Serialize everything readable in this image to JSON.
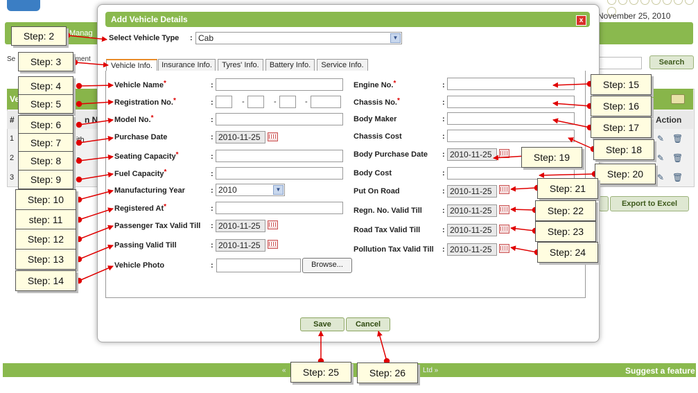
{
  "background": {
    "date": "November 25, 2010",
    "nav_text": "Manag",
    "set_text": "Se",
    "ement_text": "ement",
    "search_button": "Search",
    "table_title": "Ve",
    "col_hash": "#",
    "col_number": "n No",
    "col_action": "Action",
    "rows": [
      "1",
      "2",
      "3"
    ],
    "row_fragments": [
      "ith",
      "a",
      ""
    ],
    "export_button": "Export to Excel",
    "footer_left": "«",
    "footer_ltd": "Ltd »",
    "footer_suggest": "Suggest a feature"
  },
  "modal": {
    "title": "Add Vehicle Details",
    "close_label": "x",
    "vehicle_type_label": "Select Vehicle Type",
    "vehicle_type_value": "Cab",
    "tabs": [
      "Vehicle Info.",
      "Insurance Info.",
      "Tyres' Info.",
      "Battery Info.",
      "Service Info."
    ],
    "left_fields": [
      {
        "label": "Vehicle Name",
        "required": true
      },
      {
        "label": "Registration No.",
        "required": true
      },
      {
        "label": "Model No.",
        "required": true
      },
      {
        "label": "Purchase Date",
        "required": false,
        "value": "2010-11-25"
      },
      {
        "label": "Seating Capacity",
        "required": true
      },
      {
        "label": "Fuel Capacity",
        "required": true
      },
      {
        "label": "Manufacturing Year",
        "required": false,
        "value": "2010"
      },
      {
        "label": "Registered At",
        "required": true
      },
      {
        "label": "Passenger Tax Valid Till",
        "required": false,
        "value": "2010-11-25"
      },
      {
        "label": "Passing Valid Till",
        "required": false,
        "value": "2010-11-25"
      },
      {
        "label": "Vehicle Photo",
        "required": false
      }
    ],
    "right_fields": [
      {
        "label": "Engine No.",
        "required": true
      },
      {
        "label": "Chassis No.",
        "required": true
      },
      {
        "label": "Body Maker",
        "required": false
      },
      {
        "label": "Chassis Cost",
        "required": false
      },
      {
        "label": "Body Purchase Date",
        "required": false,
        "value": "2010-11-25"
      },
      {
        "label": "Body Cost",
        "required": false
      },
      {
        "label": "Put On Road",
        "required": false,
        "value": "2010-11-25"
      },
      {
        "label": "Regn. No. Valid Till",
        "required": false,
        "value": "2010-11-25"
      },
      {
        "label": "Road Tax Valid Till",
        "required": false,
        "value": "2010-11-25"
      },
      {
        "label": "Pollution Tax Valid Till",
        "required": false,
        "value": "2010-11-25"
      }
    ],
    "browse_label": "Browse...",
    "reg_separator": "-",
    "colon": ":",
    "save_label": "Save",
    "cancel_label": "Cancel"
  },
  "steps": [
    "Step: 2",
    "Step: 3",
    "Step: 4",
    "Step: 5",
    "Step: 6",
    "Step: 7",
    "Step: 8",
    "Step: 9",
    "Step: 10",
    "step: 11",
    "Step: 12",
    "Step: 13",
    "Step: 14",
    "Step: 15",
    "Step: 16",
    "Step: 17",
    "Step: 18",
    "Step: 19",
    "Step: 20",
    "Step: 21",
    "Step: 22",
    "Step: 23",
    "Step: 24",
    "Step: 25",
    "Step: 26"
  ],
  "colors": {
    "accent_green": "#8ab94e",
    "arrow_red": "#e00000",
    "callout_bg": "#fffde0",
    "tab_active_border": "#e98c2a"
  },
  "icons": [
    "close-icon",
    "calendar-icon",
    "dropdown-arrow-icon",
    "edit-icon",
    "delete-icon",
    "folder-icon"
  ]
}
